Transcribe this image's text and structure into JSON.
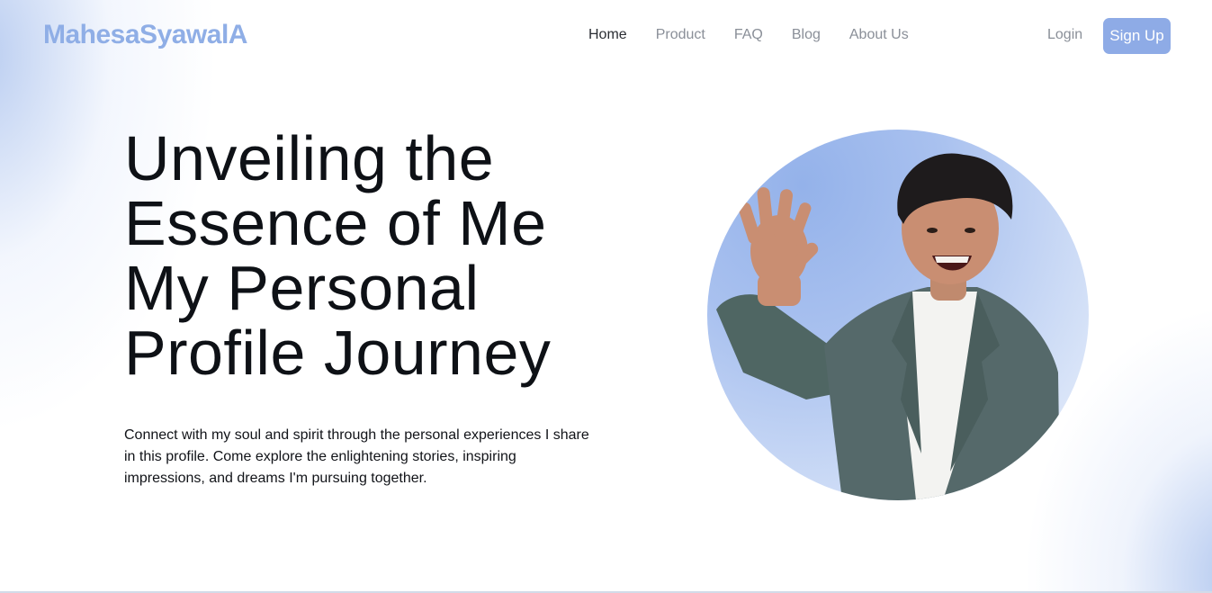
{
  "brand": {
    "logo": "MahesaSyawalA",
    "accent_color": "#8eabe6"
  },
  "nav": {
    "items": [
      {
        "label": "Home",
        "active": true
      },
      {
        "label": "Product",
        "active": false
      },
      {
        "label": "FAQ",
        "active": false
      },
      {
        "label": "Blog",
        "active": false
      },
      {
        "label": "About Us",
        "active": false
      }
    ]
  },
  "auth": {
    "login_label": "Login",
    "signup_label": "Sign Up"
  },
  "hero": {
    "headline_lines": [
      "Unveiling the",
      "Essence of Me",
      "My Personal",
      "Profile Journey"
    ],
    "subtext": "Connect with my soul and spirit through the personal experiences I share in this profile. Come explore the enlightening stories, inspiring impressions, and dreams I'm pursuing together.",
    "image": "profile-photo-waving-man-in-grey-blazer"
  }
}
